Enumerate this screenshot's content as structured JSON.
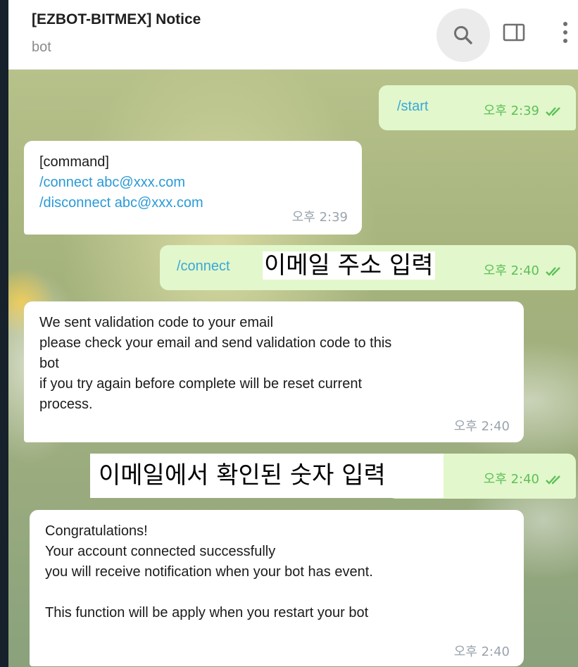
{
  "header": {
    "title": "[EZBOT-BITMEX] Notice",
    "subtitle": "bot",
    "search_icon": "search-icon",
    "panel_icon": "sidebar-panel-icon",
    "more_icon": "vertical-dots-icon"
  },
  "messages": [
    {
      "direction": "outgoing",
      "lines": [
        "/start"
      ],
      "time": "오후 2:39",
      "read": true
    },
    {
      "direction": "incoming",
      "lines": [
        "[command]",
        "/connect abc@xxx.com",
        "/disconnect abc@xxx.com"
      ],
      "time": "오후 2:39"
    },
    {
      "direction": "outgoing",
      "lines": [
        "/connect"
      ],
      "time": "오후 2:40",
      "read": true
    },
    {
      "direction": "incoming",
      "lines": [
        "We sent validation code to your email",
        "please check your email and send validation code to this",
        "bot",
        "if you try again before complete will be reset current",
        "process."
      ],
      "time": "오후 2:40"
    },
    {
      "direction": "outgoing",
      "lines": [],
      "time": "오후 2:40",
      "read": true
    },
    {
      "direction": "incoming",
      "lines": [
        "Congratulations!",
        "Your account connected successfully",
        "you will receive notification when your bot has event.",
        "",
        "This function will be apply when you restart your bot"
      ],
      "time": "오후 2:40"
    }
  ],
  "annotations": {
    "email_placeholder": "이메일 주소 입력",
    "code_placeholder": "이메일에서 확인된 숫자 입력"
  },
  "colors": {
    "outgoing_bubble": "#e2f7cb",
    "incoming_bubble": "#ffffff",
    "link": "#2a9ad6",
    "checkmark": "#5fbf5a"
  }
}
